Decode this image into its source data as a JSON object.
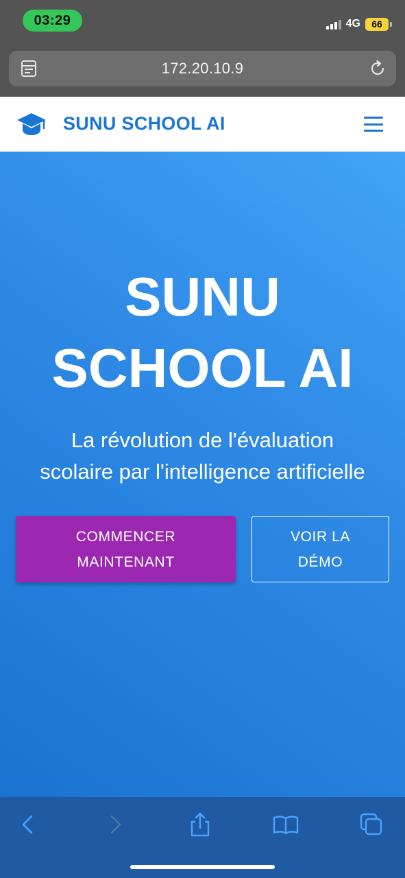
{
  "status_bar": {
    "time": "03:29",
    "network": "4G",
    "battery": "66"
  },
  "browser": {
    "url": "172.20.10.9"
  },
  "header": {
    "brand": "SUNU SCHOOL AI"
  },
  "hero": {
    "title_line1": "SUNU",
    "title_line2": "SCHOOL AI",
    "subtitle_line1": "La révolution de l'évaluation",
    "subtitle_line2": "scolaire par l'intelligence artificielle",
    "primary_button": {
      "line1": "COMMENCER",
      "line2": "MAINTENANT"
    },
    "secondary_button": {
      "line1": "VOIR LA",
      "line2": "DÉMO"
    }
  },
  "colors": {
    "brand_blue": "#1976d2",
    "primary_button": "#9c27b0",
    "status_pill": "#34c759",
    "battery": "#f7d23a",
    "toolbar": "#1f5aa3"
  },
  "icons": {
    "header_logo": "graduation-cap-icon",
    "menu": "hamburger-menu-icon",
    "address_left": "tabs-list-icon",
    "address_right": "reload-icon",
    "toolbar": [
      "back-icon",
      "forward-icon",
      "share-icon",
      "bookmarks-icon",
      "tabs-icon"
    ]
  }
}
